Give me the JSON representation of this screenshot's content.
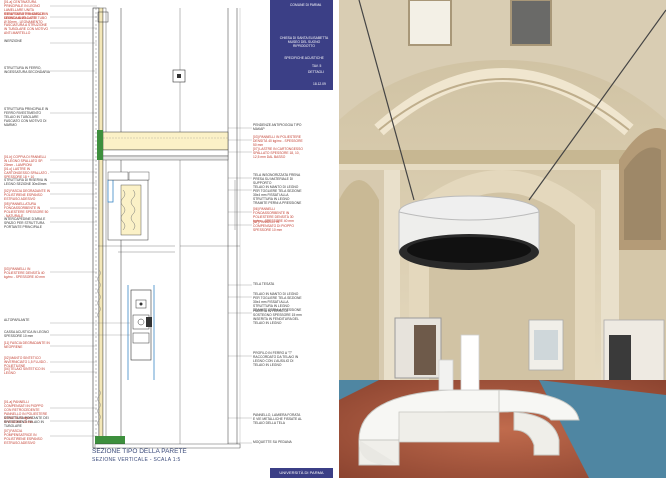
{
  "drawing": {
    "labels_left": [
      "[01.a] CENTINATURA PRINCIPALE IN LEGNO LAMELLARE UNITA RIEMPIMENTO IN MACCHI SEMIGIANI 20 GATTE",
      "STRUTTURA PRINCIPALE IN LEGNO LAMELLARE: TUBO Ø 30mm - LEGNAMENTO",
      "FASCIATURA A STRUZIONE IN TUBOLARE CON MOTIVO ANTI-MARTELLO",
      "INERZIONE",
      "STRUTTURA IN FERRO, INGESSATURA SECONDARIA",
      "STRUTTURA PRINCIPALE IN FERRO RIVESTIMENTO TELAIO IN TUBOLARE FASCIATO CON MOTIVO DI MARMO",
      "[01.b] COPPIA DI PANNELLI IN LEGNO SPALLATO SP. 20mm - LAMPIONI",
      "[01.c] LASTRE IN CARTONGESSO SPALLATO - SPESSORE 18 + 10",
      "STRUTTURA DI RISERVA IN LEGNO SEZIONE 30x40mm",
      "[02] FASCIA DEGRADANTE IN POLISTIRENE ESPANSO ESTRUSO ADESIVO",
      "[05] PANNELLATURA FONOASSORBENTE IN POLIESTERE SPESSORE 50 - NATURALE",
      "INTERCAPEDINE D'ARIA E SPAZIO PER STRUTTURA PORTANTE PRINCIPALE",
      "[03] PANNELLI IN POLIESTERE DENSITÀ 40 kg/mc - SPESSORE 40 mm",
      "ALTOPARLANTE",
      "CASSA ACUSTICA IN LEGNO SPESSORE 10 mm",
      "[11] FASCIA DEGRADANTE IN NEOPRENE",
      "[02] MANTO SINTETICO INVERNICIATO 1,5 FLUIDO - POLIETILENE",
      "[04] TELAIO SINTETICO IN LEGNO",
      "[01.a] PANNELLI COMPENSATI IN PIOPPO CON RETROCEDENTE PANNELLO IN POLIESTERE DENSITÀ 30 kg/mc - SPESSORE 40 mm",
      "STRUTTURA PORTANTE DEI RIVESTIMENTI TELAIO IN TUBOLARE",
      "[07] FASCIA POMPENSATRICE IN POLISTIRENE ESPANSO ESTRUSO ADESIVO"
    ],
    "labels_right": [
      "PENDENZE ANTIPIOGGIA TIPO MAKAP",
      "[03] PANNELLI IN POLIESTERE DENSITÀ 40 kg/mc - SPESSORE 50 mm",
      "[07] LASTRE IN CARTONGESSO SPALLATO SPESSORE 18, 10, 12,5 mm DAL BASSO",
      "TELA INSONORIZZATA FRENA PRESA SU MATERIALE DI SUPPORTO",
      "TELAIO IN MANTO DI LEGNO PER TOGLIERE TELA SEZIONE 30x4 mm FISSATI ALLA STRUTTURA IN LEGNO TRAMITE PERNI A PRESSIONE",
      "[06] PANNELLI FONOASSORBENTE IN POLIESTERE DENSITÀ 30 kg/mc - SPESSORE 40 mm",
      "[07] PANNELLI IN COMPENSATO DI PIOPPO SPESSORE 10 mm",
      "TELA TESATA",
      "TELAIO IN MANTO DI LEGNO PER TOGLIERE TELA SEZIONE 30x4 mm FISSATI ALLA STRUTTURA IN LEGNO TRAMITE PERNI A PRESSIONE",
      "PIASTRA IN FERRO DI SOSTEGNO SPESSORE 15 mm INSERITA IN FENDITURA DEL TELAIO IN LEGNO",
      "PROFILO IN FERRO A \"T\" RACCORDATO DA TELAIO IN LEGNO CON L'AUSILIO DI TELAIO IN LEGNO",
      "PANNELLO, LAMIERA FORATA E VIE METALLICHE FISSATE AL TELAIO DELLA TELA",
      "MOQUETTE SU PEDANA"
    ],
    "title_block": {
      "client": "COMUNE DI PARMA",
      "project": "CHIESA DI SANTA ELISABETTA MUSEO DEL SUONO RIPRODOTTO",
      "subject": "SPECIFICHE ACUSTICHE",
      "sheet": "TAV. 5",
      "detail": "DETTAGLI",
      "date": "18.12.09"
    },
    "section_title": "SEZIONE TIPO DELLA PARETE",
    "section_subtitle": "SEZIONE VERTICALE - SCALA 1:5",
    "footer": "UNIVERSITÀ DI PARMA"
  },
  "colors": {
    "title_block": "#3b3f86",
    "label_red": "#c0392b",
    "wall_cream": "#e8dcc2",
    "floor_red": "#a5563d",
    "floor_blue": "#5a8ea8",
    "ceiling_shadow": "#b9ad98",
    "white_furniture": "#f4f3ef"
  }
}
